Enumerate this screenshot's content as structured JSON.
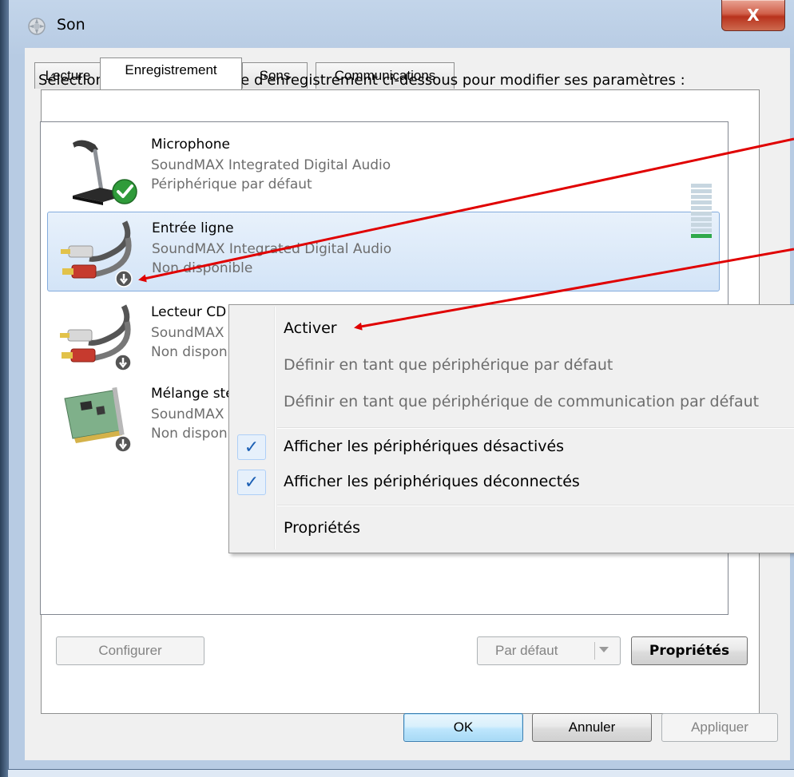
{
  "window": {
    "title": "Son",
    "close_glyph": "X"
  },
  "tabs": [
    {
      "label": "Lecture",
      "active": false
    },
    {
      "label": "Enregistrement",
      "active": true
    },
    {
      "label": "Sons",
      "active": false
    },
    {
      "label": "Communications",
      "active": false
    }
  ],
  "instructions": "Sélectionnez un périphérique d'enregistrement ci-dessous pour modifier ses paramètres :",
  "devices": [
    {
      "name": "Microphone",
      "driver": "SoundMAX Integrated Digital Audio",
      "status": "Périphérique par défaut",
      "icon": "microphone-icon",
      "badge": "default-check-icon"
    },
    {
      "name": "Entrée ligne",
      "driver": "SoundMAX Integrated Digital Audio",
      "status": "Non disponible",
      "icon": "rca-cable-icon",
      "badge": "disabled-arrow-icon",
      "selected": true
    },
    {
      "name": "Lecteur CD",
      "driver": "SoundMAX Integrated Digital Audio",
      "status": "Non disponible",
      "icon": "rca-cable-icon",
      "badge": "disabled-arrow-icon"
    },
    {
      "name": "Mélange stéréo",
      "driver": "SoundMAX Integrated Digital Audio",
      "status": "Non disponible",
      "icon": "sound-card-icon",
      "badge": "disabled-arrow-icon"
    }
  ],
  "level_meter": {
    "bars": 10,
    "lit": 1,
    "color_on": "#2fa84a",
    "color_off": "#c7d6e0"
  },
  "buttons": {
    "configure": "Configurer",
    "set_default": "Par défaut",
    "properties": "Propriétés",
    "ok": "OK",
    "cancel": "Annuler",
    "apply": "Appliquer"
  },
  "context_menu": {
    "items": [
      {
        "label": "Activer",
        "enabled": true
      },
      {
        "label": "Définir en tant que périphérique par défaut",
        "enabled": false
      },
      {
        "label": "Définir en tant que périphérique de communication par défaut",
        "enabled": false
      },
      {
        "label": "Afficher les périphériques désactivés",
        "checked": true
      },
      {
        "label": "Afficher les périphériques déconnectés",
        "checked": true
      },
      {
        "label": "Propriétés",
        "enabled": true
      }
    ],
    "check_glyph": "✓"
  },
  "annotation": {
    "arrow_color": "#e00000"
  }
}
